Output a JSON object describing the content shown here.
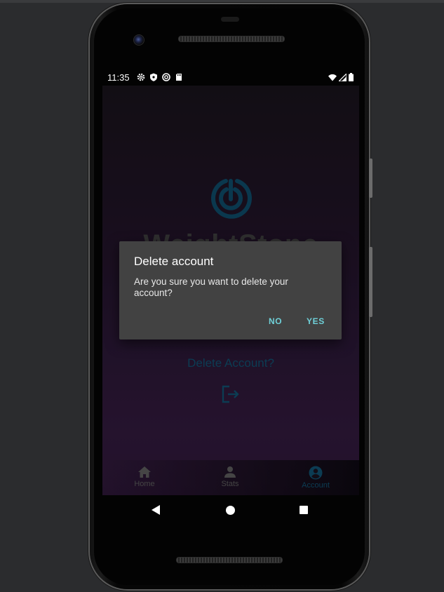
{
  "status_bar": {
    "time": "11:35",
    "left_icons": [
      "gear-icon",
      "shield-icon",
      "sync-icon",
      "sd-card-icon"
    ],
    "right_icons": [
      "wifi-icon",
      "signal-icon",
      "battery-icon"
    ]
  },
  "app": {
    "title": "WeightStone",
    "accent_color": "#0f4a66",
    "delete_link": "Delete Account?"
  },
  "bottom_nav": {
    "items": [
      {
        "label": "Home",
        "icon": "home-icon",
        "active": false
      },
      {
        "label": "Stats",
        "icon": "person-icon",
        "active": false
      },
      {
        "label": "Account",
        "icon": "account-circle-icon",
        "active": true
      }
    ]
  },
  "dialog": {
    "title": "Delete account",
    "message": "Are you sure you want to delete your account?",
    "no_label": "NO",
    "yes_label": "YES",
    "button_color": "#6fd0d8"
  }
}
